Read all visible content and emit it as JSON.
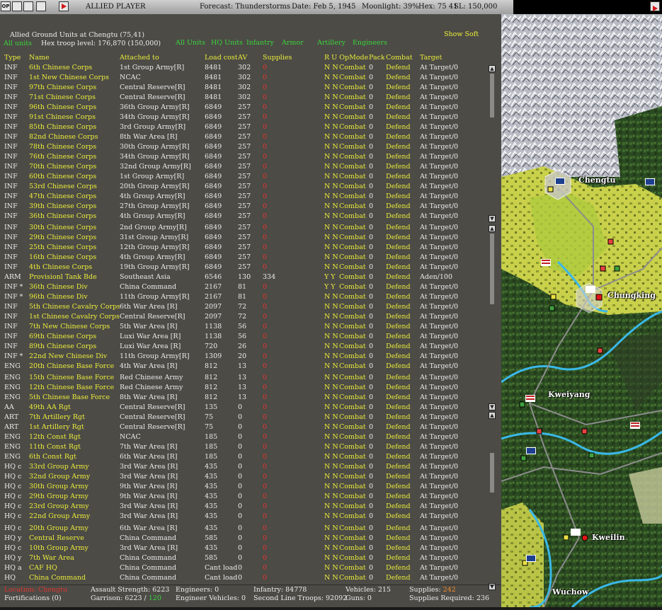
{
  "topbar": {
    "player": "ALLIED PLAYER",
    "forecast": "Forecast: Thunderstorms",
    "date": "Date: Feb 5, 1945",
    "moonlight": "Moonlight: 39%",
    "hex": "Hex: 75 41",
    "sl": "SL: 150,000",
    "op_label": "OP"
  },
  "panel": {
    "header_title": "Allied Ground Units at Chengtu (75,41)",
    "all_units_left": "All units",
    "troop_level": "Hex troop level: 176,870  (150,000)",
    "show_soft": "Show Soft",
    "filters": [
      "All Units",
      "HQ Units",
      "Infantry",
      "Armor",
      "Artillery",
      "Engineers"
    ]
  },
  "columns": {
    "type": "Type",
    "name": "Name",
    "attached": "Attached to",
    "load": "Load cost",
    "av": "AV",
    "supplies": "Supplies",
    "ru_opmode": "R U OpMode",
    "pack": "Pack",
    "combat": "Combat",
    "target": "Target"
  },
  "units": [
    [
      "INF",
      "6th Chinese Corps",
      "1st Group Army[R]",
      "8481",
      "302",
      "0",
      "N N",
      "Combat",
      "0",
      "Defend",
      "At Target/0"
    ],
    [
      "INF",
      "1st New Chinese Corps",
      "NCAC",
      "8481",
      "302",
      "0",
      "N N",
      "Combat",
      "0",
      "Defend",
      "At Target/0"
    ],
    [
      "INF",
      "97th Chinese Corps",
      "Central Reserve[R]",
      "8481",
      "302",
      "0",
      "N N",
      "Combat",
      "0",
      "Defend",
      "At Target/0"
    ],
    [
      "INF",
      "71st Chinese Corps",
      "Central Reserve[R]",
      "8481",
      "302",
      "0",
      "N N",
      "Combat",
      "0",
      "Defend",
      "At Target/0"
    ],
    [
      "INF",
      "96th Chinese Corps",
      "36th Group Army[R]",
      "6849",
      "257",
      "0",
      "N N",
      "Combat",
      "0",
      "Defend",
      "At Target/0"
    ],
    [
      "INF",
      "91st Chinese Corps",
      "34th Group Army[R]",
      "6849",
      "257",
      "0",
      "N N",
      "Combat",
      "0",
      "Defend",
      "At Target/0"
    ],
    [
      "INF",
      "85th Chinese Corps",
      "3rd Group Army[R]",
      "6849",
      "257",
      "0",
      "N N",
      "Combat",
      "0",
      "Defend",
      "At Target/0"
    ],
    [
      "INF",
      "82nd Chinese Corps",
      "8th War Area [R]",
      "6849",
      "257",
      "0",
      "N N",
      "Combat",
      "0",
      "Defend",
      "At Target/0"
    ],
    [
      "INF",
      "78th Chinese Corps",
      "30th Group Army[R]",
      "6849",
      "257",
      "0",
      "N N",
      "Combat",
      "0",
      "Defend",
      "At Target/0"
    ],
    [
      "INF",
      "76th Chinese Corps",
      "34th Group Army[R]",
      "6849",
      "257",
      "0",
      "N N",
      "Combat",
      "0",
      "Defend",
      "At Target/0"
    ],
    [
      "INF",
      "70th Chinese Corps",
      "32nd Group Army[R]",
      "6849",
      "257",
      "0",
      "N N",
      "Combat",
      "0",
      "Defend",
      "At Target/0"
    ],
    [
      "INF",
      "60th Chinese Corps",
      "1st Group Army[R]",
      "6849",
      "257",
      "0",
      "N N",
      "Combat",
      "0",
      "Defend",
      "At Target/0"
    ],
    [
      "INF",
      "53rd Chinese Corps",
      "20th Group Army[R]",
      "6849",
      "257",
      "0",
      "N N",
      "Combat",
      "0",
      "Defend",
      "At Target/0"
    ],
    [
      "INF",
      "47th Chinese Corps",
      "4th Group Army[R]",
      "6849",
      "257",
      "0",
      "N N",
      "Combat",
      "0",
      "Defend",
      "At Target/0"
    ],
    [
      "INF",
      "39th Chinese Corps",
      "27th Group Army[R]",
      "6849",
      "257",
      "0",
      "N N",
      "Combat",
      "0",
      "Defend",
      "At Target/0"
    ],
    [
      "INF",
      "36th Chinese Corps",
      "4th Group Army[R]",
      "6849",
      "257",
      "0",
      "N N",
      "Combat",
      "0",
      "Defend",
      "At Target/0"
    ],
    [
      "INF",
      "30th Chinese Corps",
      "2nd Group Army[R]",
      "6849",
      "257",
      "0",
      "N N",
      "Combat",
      "0",
      "Defend",
      "At Target/0"
    ],
    [
      "INF",
      "29th Chinese Corps",
      "31st Group Army[R]",
      "6849",
      "257",
      "0",
      "N N",
      "Combat",
      "0",
      "Defend",
      "At Target/0"
    ],
    [
      "INF",
      "25th Chinese Corps",
      "12th Group Army[R]",
      "6849",
      "257",
      "0",
      "N N",
      "Combat",
      "0",
      "Defend",
      "At Target/0"
    ],
    [
      "INF",
      "16th Chinese Corps",
      "4th Group Army[R]",
      "6849",
      "257",
      "0",
      "N N",
      "Combat",
      "0",
      "Defend",
      "At Target/0"
    ],
    [
      "INF",
      "4th Chinese Corps",
      "19th Group Army[R]",
      "6849",
      "257",
      "0",
      "N N",
      "Combat",
      "0",
      "Defend",
      "At Target/0"
    ],
    [
      "ARM",
      "Provisionl Tank Bde",
      "Southeast Asia",
      "6546",
      "130",
      "334",
      "Y Y",
      "Combat",
      "0",
      "Defend",
      "Aden/100"
    ],
    [
      "INF *",
      "36th Chinese Div",
      "China Command",
      "2167",
      "81",
      "0",
      "Y Y",
      "Combat",
      "0",
      "Defend",
      "At Target/0"
    ],
    [
      "INF *",
      "96th Chinese Div",
      "11th Group Army[R]",
      "2167",
      "81",
      "0",
      "N N",
      "Combat",
      "0",
      "Defend",
      "At Target/0"
    ],
    [
      "INF",
      "5th Chinese Cavalry Corps",
      "6th War Area [R]",
      "2097",
      "72",
      "0",
      "N N",
      "Combat",
      "0",
      "Defend",
      "At Target/0"
    ],
    [
      "INF",
      "1st Chinese Cavalry Corps",
      "Central Reserve[R]",
      "2097",
      "72",
      "0",
      "N N",
      "Combat",
      "0",
      "Defend",
      "At Target/0"
    ],
    [
      "INF",
      "7th New Chinese Corps",
      "5th War Area [R]",
      "1138",
      "56",
      "0",
      "N N",
      "Combat",
      "0",
      "Defend",
      "At Target/0"
    ],
    [
      "INF",
      "69th Chinese Corps",
      "Luxi War Area [R]",
      "1138",
      "56",
      "0",
      "N N",
      "Combat",
      "0",
      "Defend",
      "At Target/0"
    ],
    [
      "INF",
      "89th Chinese Corps",
      "Luxi War Area [R]",
      "720",
      "26",
      "0",
      "N N",
      "Combat",
      "0",
      "Defend",
      "At Target/0"
    ],
    [
      "INF *",
      "22nd New Chinese Div",
      "11th Group Army[R]",
      "1309",
      "20",
      "0",
      "N N",
      "Combat",
      "0",
      "Defend",
      "At Target/0"
    ],
    [
      "ENG",
      "20th Chinese Base Force",
      "4th War Area [R]",
      "812",
      "13",
      "0",
      "N N",
      "Combat",
      "0",
      "Defend",
      "At Target/0"
    ],
    [
      "ENG",
      "15th Chinese Base Force",
      "Red Chinese Army",
      "812",
      "13",
      "0",
      "N N",
      "Combat",
      "0",
      "Defend",
      "At Target/0"
    ],
    [
      "ENG",
      "12th Chinese Base Force",
      "Red Chinese Army",
      "812",
      "13",
      "0",
      "N N",
      "Combat",
      "0",
      "Defend",
      "At Target/0"
    ],
    [
      "ENG",
      "5th Chinese Base Force",
      "8th War Area [R]",
      "812",
      "13",
      "0",
      "N N",
      "Combat",
      "0",
      "Defend",
      "At Target/0"
    ],
    [
      "AA",
      "49th AA Rgt",
      "Central Reserve[R]",
      "135",
      "0",
      "0",
      "N N",
      "Combat",
      "0",
      "Defend",
      "At Target/0"
    ],
    [
      "ART",
      "7th Artillery Rgt",
      "Central Reserve[R]",
      "75",
      "0",
      "0",
      "N N",
      "Combat",
      "0",
      "Defend",
      "At Target/0"
    ],
    [
      "ART",
      "1st Artillery Rgt",
      "Central Reserve[R]",
      "75",
      "0",
      "0",
      "N N",
      "Combat",
      "0",
      "Defend",
      "At Target/0"
    ],
    [
      "ENG",
      "12th Const Rgt",
      "NCAC",
      "185",
      "0",
      "0",
      "N N",
      "Combat",
      "0",
      "Defend",
      "At Target/0"
    ],
    [
      "ENG",
      "11th Const Rgt",
      "7th War Area [R]",
      "185",
      "0",
      "0",
      "N N",
      "Combat",
      "0",
      "Defend",
      "At Target/0"
    ],
    [
      "ENG",
      "6th Const Rgt",
      "6th War Area [R]",
      "185",
      "0",
      "0",
      "N N",
      "Combat",
      "0",
      "Defend",
      "At Target/0"
    ],
    [
      "HQ c",
      "33rd Group Army",
      "3rd War Area [R]",
      "435",
      "0",
      "0",
      "N N",
      "Combat",
      "0",
      "Defend",
      "At Target/0"
    ],
    [
      "HQ c",
      "32nd Group Army",
      "3rd War Area [R]",
      "435",
      "0",
      "0",
      "N N",
      "Combat",
      "0",
      "Defend",
      "At Target/0"
    ],
    [
      "HQ c",
      "30th Group Army",
      "9th War Area [R]",
      "435",
      "0",
      "0",
      "N N",
      "Combat",
      "0",
      "Defend",
      "At Target/0"
    ],
    [
      "HQ c",
      "29th Group Army",
      "9th War Area [R]",
      "435",
      "0",
      "0",
      "N N",
      "Combat",
      "0",
      "Defend",
      "At Target/0"
    ],
    [
      "HQ c",
      "23rd Group Army",
      "3rd War Area [R]",
      "435",
      "0",
      "0",
      "N N",
      "Combat",
      "0",
      "Defend",
      "At Target/0"
    ],
    [
      "HQ c",
      "22nd Group Army",
      "3rd War Area [R]",
      "435",
      "0",
      "0",
      "N N",
      "Combat",
      "0",
      "Defend",
      "At Target/0"
    ],
    [
      "HQ c",
      "20th Group Army",
      "6th War Area [R]",
      "435",
      "0",
      "0",
      "N N",
      "Combat",
      "0",
      "Defend",
      "At Target/0"
    ],
    [
      "HQ y",
      "Central Reserve",
      "China Command",
      "585",
      "0",
      "0",
      "N N",
      "Combat",
      "0",
      "Defend",
      "At Target/0"
    ],
    [
      "HQ c",
      "10th Group Army",
      "3rd War Area [R]",
      "435",
      "0",
      "0",
      "N N",
      "Combat",
      "0",
      "Defend",
      "At Target/0"
    ],
    [
      "HQ y",
      "7th War Area",
      "China Command",
      "585",
      "0",
      "0",
      "N N",
      "Combat",
      "0",
      "Defend",
      "At Target/0"
    ],
    [
      "HQ a",
      "CAF HQ",
      "China Command",
      "Cant load",
      "0",
      "0",
      "N N",
      "Combat",
      "0",
      "Defend",
      "At Target/0"
    ],
    [
      "HQ",
      "China Command",
      "China Command",
      "Cant load",
      "0",
      "0",
      "N N",
      "Combat",
      "0",
      "Defend",
      "At Target/0"
    ]
  ],
  "footer": {
    "location": "Location: Chengtu",
    "fortifications": "Fortifications (0)",
    "assault_strength": "Assault Strength: 6223",
    "garrison_label": "Garrison: 6223 /",
    "garrison_req": "120",
    "engineers": "Engineers: 0",
    "engineer_vehicles": "Engineer Vehicles: 0",
    "infantry": "Infantry: 84778",
    "second_line": "Second Line Troops: 92092",
    "vehicles": "Vehicles: 215",
    "guns": "Guns: 0",
    "supplies_label": "Supplies:",
    "supplies_value": "242",
    "supplies_required": "Supplies Required: 236"
  },
  "map": {
    "cities": [
      "Chengtu",
      "Chungking",
      "Kweiyang",
      "Kweilin",
      "Wuchow"
    ]
  },
  "colors": {
    "panel_bg": "#4c4b46",
    "unit_name": "#ecec3a",
    "filter_green": "#3bd43b",
    "alert_red": "#e0342f"
  }
}
